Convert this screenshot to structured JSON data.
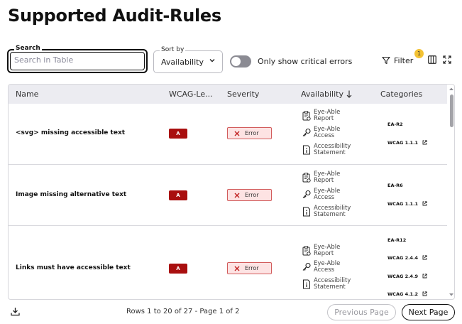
{
  "page": {
    "title": "Supported Audit-Rules"
  },
  "toolbar": {
    "search_label": "Search",
    "search_placeholder": "Search in Table",
    "sort_label": "Sort by",
    "sort_value": "Availability",
    "toggle_label": "Only show critical errors",
    "toggle_on": false,
    "filter_label": "Filter",
    "filter_count": "1"
  },
  "table": {
    "columns": [
      "Name",
      "WCAG-Le...",
      "Severity",
      "Availability",
      "Categories"
    ],
    "rows": [
      {
        "name": "<svg> missing accessible text",
        "level": "A",
        "severity": "Error",
        "availability": [
          "Eye-Able Report",
          "Eye-Able Access",
          "Accessibility Statement"
        ],
        "categories": [
          "EA-R2",
          "WCAG 1.1.1"
        ]
      },
      {
        "name": "Image missing alternative text",
        "level": "A",
        "severity": "Error",
        "availability": [
          "Eye-Able Report",
          "Eye-Able Access",
          "Accessibility Statement"
        ],
        "categories": [
          "EA-R6",
          "WCAG 1.1.1"
        ]
      },
      {
        "name": "Links must have accessible text",
        "level": "A",
        "severity": "Error",
        "availability": [
          "Eye-Able Report",
          "Eye-Able Access",
          "Accessibility Statement"
        ],
        "categories": [
          "EA-R12",
          "WCAG 2.4.4",
          "WCAG 2.4.9",
          "WCAG 4.1.2"
        ]
      }
    ]
  },
  "footer": {
    "pagination_text": "Rows 1 to 20 of 27 - Page 1 of 2",
    "prev_label": "Previous Page",
    "next_label": "Next Page"
  },
  "colors": {
    "level_badge": "#a90f0f",
    "error_badge_bg": "#fde3e3",
    "error_badge_border": "#d25b5b",
    "filter_badge": "#f3c233",
    "header_bg": "#ececf1"
  }
}
